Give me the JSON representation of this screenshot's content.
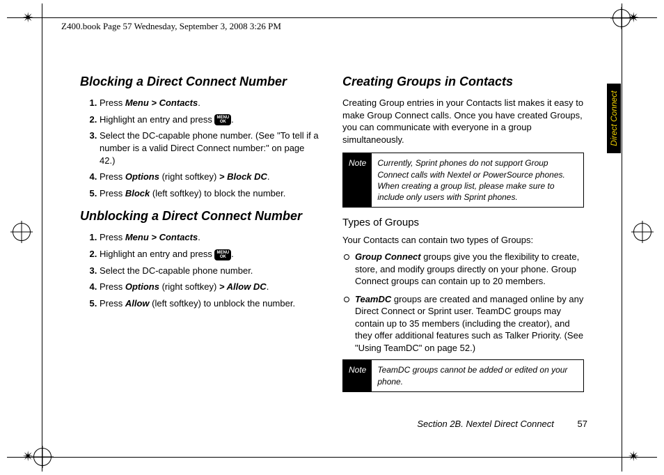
{
  "header": "Z400.book  Page 57  Wednesday, September 3, 2008  3:26 PM",
  "side_tab": "Direct Connect",
  "left": {
    "h_block": "Blocking a Direct Connect Number",
    "block_steps": {
      "s1a": "Press ",
      "s1b": "Menu > Contacts",
      "s1c": ".",
      "s2a": "Highlight an entry and press ",
      "s2b": ".",
      "s3": "Select the DC-capable phone number. (See \"To tell if a number is a valid Direct Connect number:\" on page 42.)",
      "s4a": "Press ",
      "s4b": "Options",
      "s4c": " (right softkey) ",
      "s4d": "> Block DC",
      "s4e": ".",
      "s5a": "Press ",
      "s5b": "Block",
      "s5c": " (left softkey) to block the number."
    },
    "h_unblock": "Unblocking a Direct Connect Number",
    "unblock_steps": {
      "s1a": "Press ",
      "s1b": "Menu > Contacts",
      "s1c": ".",
      "s2a": "Highlight an entry and press ",
      "s2b": ".",
      "s3": "Select the DC-capable phone number.",
      "s4a": "Press ",
      "s4b": "Options",
      "s4c": " (right softkey) ",
      "s4d": "> Allow DC",
      "s4e": ".",
      "s5a": "Press ",
      "s5b": "Allow",
      "s5c": " (left softkey) to unblock the number."
    }
  },
  "right": {
    "h_create": "Creating Groups in Contacts",
    "intro": "Creating Group entries in your Contacts list makes it easy to make Group Connect calls. Once you have created Groups, you can communicate with everyone in a group simultaneously.",
    "note1_label": "Note",
    "note1_text": "Currently, Sprint phones do not support Group Connect calls with Nextel or PowerSource phones. When creating a group list, please make sure to include only users with Sprint phones.",
    "h_types": "Types of Groups",
    "types_intro": "Your Contacts can contain two types of Groups:",
    "li1a": "Group Connect",
    "li1b": " groups give you the flexibility to create, store, and modify groups directly on your phone. Group Connect groups can contain up to 20 members.",
    "li2a": "TeamDC",
    "li2b": " groups are created and managed online by any Direct Connect or Sprint user. TeamDC groups may contain up to 35 members (including the creator), and they offer additional features such as Talker Priority. (See \"Using TeamDC\" on page 52.)",
    "note2_label": "Note",
    "note2_text": "TeamDC groups cannot be added or edited on your phone."
  },
  "footer": {
    "section": "Section 2B. Nextel Direct Connect",
    "page": "57"
  },
  "menu_key": {
    "l1": "MENU",
    "l2": "OK"
  }
}
